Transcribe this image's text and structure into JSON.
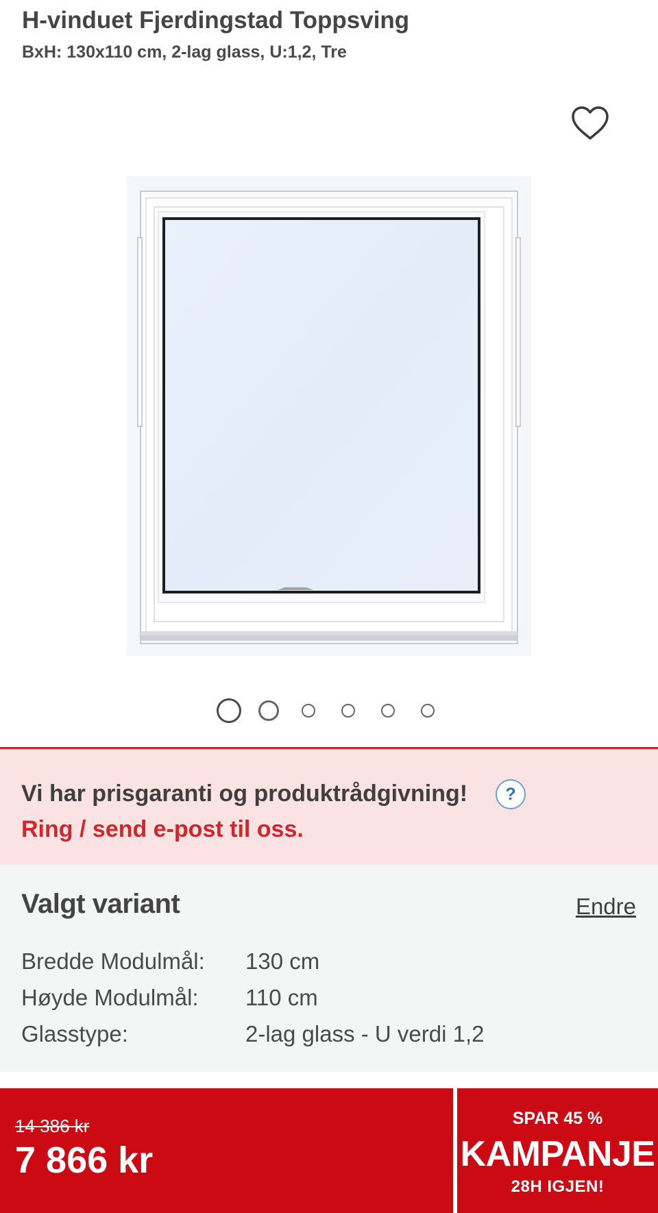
{
  "product": {
    "title": "H-vinduet Fjerdingstad Toppsving",
    "subtitle": "BxH: 130x110 cm, 2-lag glass, U:1,2, Tre"
  },
  "favorite_icon": "heart-outline-icon",
  "gallery": {
    "image_count": 6,
    "active_index": 0
  },
  "promo": {
    "line1": "Vi har prisgaranti og produktrådgivning!",
    "line2": "Ring / send e-post til oss.",
    "help_symbol": "?"
  },
  "variant": {
    "title": "Valgt variant",
    "edit_label": "Endre",
    "specs": [
      {
        "label": "Bredde Modulmål:",
        "value": "130 cm"
      },
      {
        "label": "Høyde Modulmål:",
        "value": "110 cm"
      },
      {
        "label": "Glasstype:",
        "value": "2-lag glass - U verdi 1,2"
      }
    ]
  },
  "price": {
    "old": "14 386 kr",
    "current": "7 866 kr"
  },
  "campaign": {
    "top": "SPAR 45 %",
    "main": "KAMPANJE",
    "bottom": "28H IGJEN!"
  },
  "colors": {
    "brand_red": "#cc0a14",
    "promo_bg": "#fbe3e4",
    "promo_red_text": "#d3262b",
    "variant_bg": "#f4f6f6"
  }
}
